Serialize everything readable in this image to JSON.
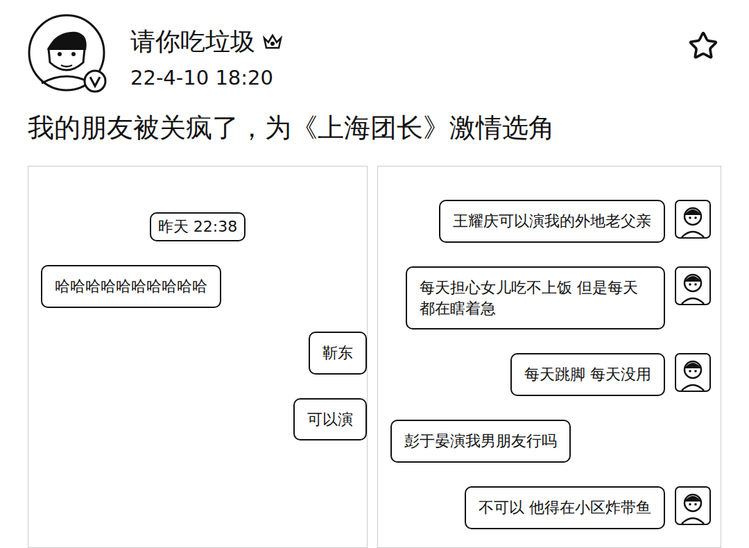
{
  "post": {
    "author": "请你吃垃圾",
    "time": "22-4-10 18:20",
    "text": "我的朋友被关疯了，为《上海团长》激情选角",
    "favorited": false,
    "verified": true
  },
  "screenshots": [
    {
      "timestamp": "昨天 22:38",
      "messages": [
        {
          "text": "哈哈哈哈哈哈哈哈哈哈",
          "kind": "received",
          "avatar": false
        },
        {
          "text": "靳东",
          "kind": "sent",
          "avatar": false
        },
        {
          "text": "可以演",
          "kind": "sent",
          "avatar": false
        }
      ]
    },
    {
      "timestamp": "",
      "messages": [
        {
          "text": "王耀庆可以演我的外地老父亲",
          "kind": "sent",
          "avatar": true
        },
        {
          "text": "每天担心女儿吃不上饭 但是每天都在瞎着急",
          "kind": "sent",
          "avatar": true
        },
        {
          "text": "每天跳脚 每天没用",
          "kind": "sent",
          "avatar": true
        },
        {
          "text": "彭于晏演我男朋友行吗",
          "kind": "received",
          "avatar": false
        },
        {
          "text": "不可以 他得在小区炸带鱼",
          "kind": "sent",
          "avatar": true
        }
      ]
    }
  ]
}
